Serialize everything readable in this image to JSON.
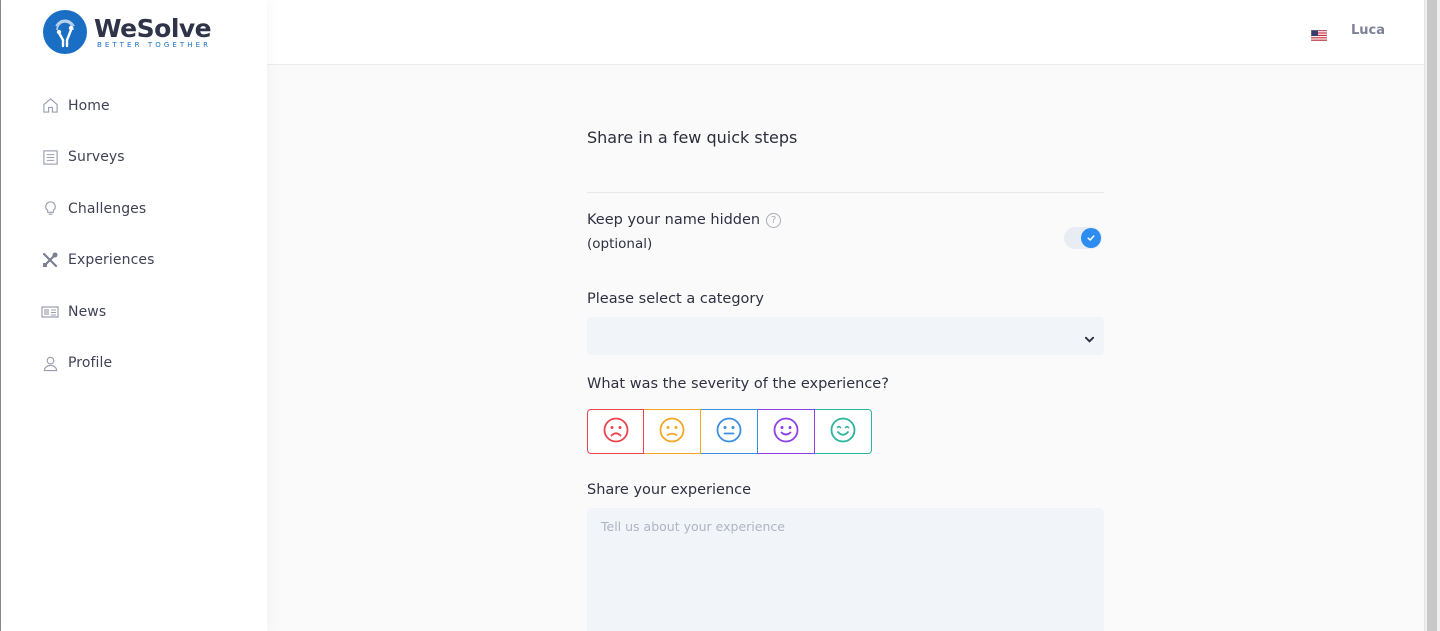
{
  "brand": {
    "name": "WeSolve",
    "tagline": "BETTER TOGETHER",
    "color": "#1a6fc4"
  },
  "sidebar": {
    "items": [
      {
        "label": "Home",
        "icon": "home-icon"
      },
      {
        "label": "Surveys",
        "icon": "list-icon"
      },
      {
        "label": "Challenges",
        "icon": "lightbulb-icon"
      },
      {
        "label": "Experiences",
        "icon": "tools-icon"
      },
      {
        "label": "News",
        "icon": "newspaper-icon"
      },
      {
        "label": "Profile",
        "icon": "user-icon"
      }
    ]
  },
  "header": {
    "language_flag": "us-flag-icon",
    "user_name": "Luca"
  },
  "form": {
    "title": "Share in a few quick steps",
    "hide_name_label": "Keep your name hidden",
    "hide_name_help": "?",
    "hide_name_optional": "(optional)",
    "hide_name_enabled": true,
    "category_label": "Please select a category",
    "category_value": "",
    "severity_label": "What was the severity of the experience?",
    "severity_options": [
      {
        "icon": "very-sad-face-icon",
        "color": "#e8454f"
      },
      {
        "icon": "sad-face-icon",
        "color": "#f5a623"
      },
      {
        "icon": "neutral-face-icon",
        "color": "#3a8fe0"
      },
      {
        "icon": "happy-face-icon",
        "color": "#8d3fe8"
      },
      {
        "icon": "very-happy-face-icon",
        "color": "#2bb5a0"
      }
    ],
    "experience_label": "Share your experience",
    "experience_placeholder": "Tell us about your experience",
    "accent_color": "#2d8cf0"
  }
}
